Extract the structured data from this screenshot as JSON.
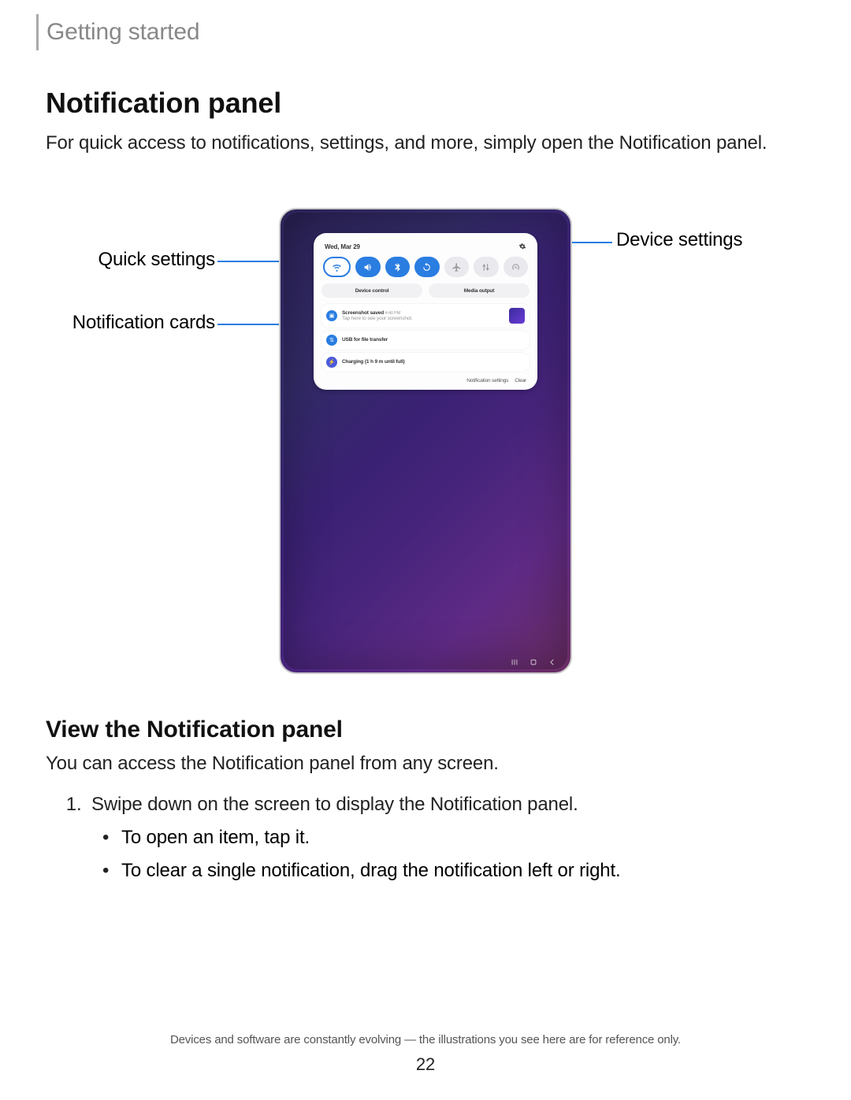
{
  "breadcrumb": "Getting started",
  "title": "Notification panel",
  "intro": "For quick access to notifications, settings, and more, simply open the Notification panel.",
  "callouts": {
    "quick_settings": "Quick settings",
    "notification_cards": "Notification cards",
    "device_settings": "Device settings"
  },
  "shade": {
    "date": "Wed, Mar 29",
    "toggles": [
      "wifi",
      "sound",
      "bluetooth",
      "rotate",
      "airplane",
      "arrows",
      "hotspot"
    ],
    "buttons": {
      "device_control": "Device control",
      "media_output": "Media output"
    },
    "cards": [
      {
        "icon": "screenshot",
        "title": "Screenshot saved",
        "time": "4:40 PM",
        "sub": "Tap here to see your screenshot.",
        "thumb": true
      },
      {
        "icon": "usb",
        "title": "USB for file transfer"
      },
      {
        "icon": "charge",
        "title": "Charging (1 h 9 m until full)"
      }
    ],
    "footer": {
      "settings": "Notification settings",
      "clear": "Clear"
    }
  },
  "section2": {
    "heading": "View the Notification panel",
    "para": "You can access the Notification panel from any screen.",
    "step1": "Swipe down on the screen to display the Notification panel.",
    "bullets": [
      "To open an item, tap it.",
      "To clear a single notification, drag the notification left or right."
    ]
  },
  "footnote": "Devices and software are constantly evolving — the illustrations you see here are for reference only.",
  "page_number": "22"
}
